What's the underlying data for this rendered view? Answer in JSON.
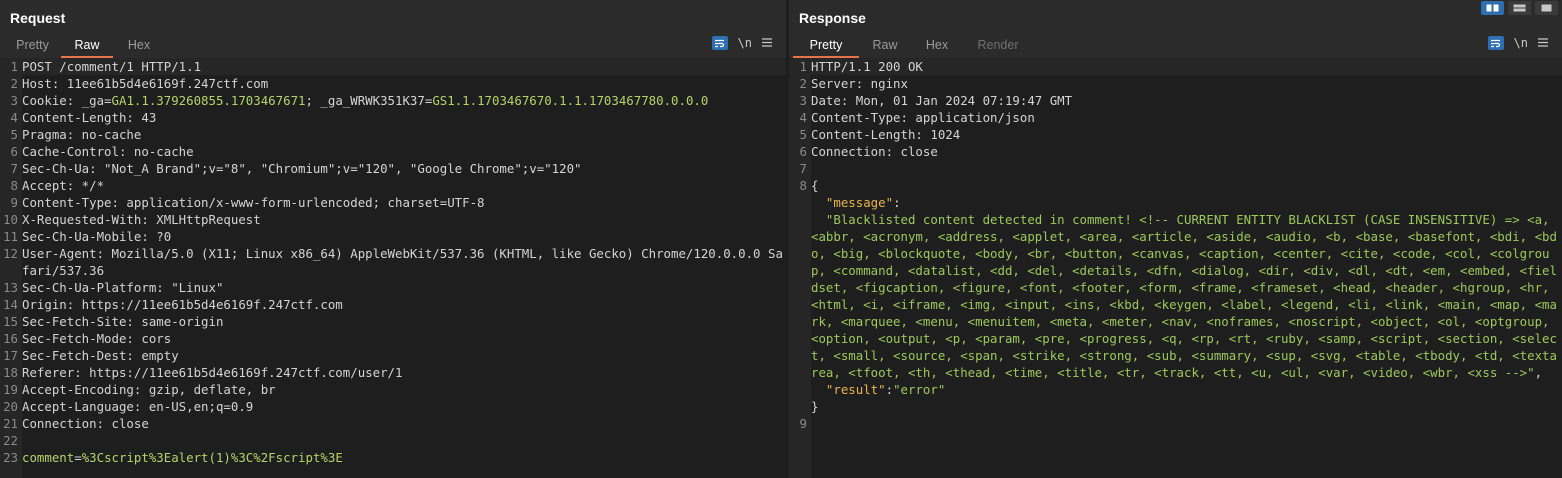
{
  "request": {
    "title": "Request",
    "tabs": [
      "Pretty",
      "Raw",
      "Hex"
    ],
    "active_tab": "Raw",
    "toolbar": {
      "newline_label": "\\n",
      "menu_icon": "hamburger-icon",
      "wrap_icon": "wrap-lines-icon"
    },
    "lines": [
      {
        "n": "1",
        "parts": [
          {
            "t": "POST /comment/1 HTTP/1.1"
          }
        ]
      },
      {
        "n": "2",
        "parts": [
          {
            "t": "Host: 11ee61b5d4e6169f.247ctf.com"
          }
        ]
      },
      {
        "n": "3",
        "parts": [
          {
            "t": "Cookie: _ga="
          },
          {
            "t": "GA1.1.379260855.1703467671",
            "c": "g"
          },
          {
            "t": "; _ga_WRWK351K37="
          },
          {
            "t": "GS1.1.1703467670.1.1.1703467780.0.0.0",
            "c": "g"
          }
        ]
      },
      {
        "n": "4",
        "parts": [
          {
            "t": "Content-Length: 43"
          }
        ]
      },
      {
        "n": "5",
        "parts": [
          {
            "t": "Pragma: no-cache"
          }
        ]
      },
      {
        "n": "6",
        "parts": [
          {
            "t": "Cache-Control: no-cache"
          }
        ]
      },
      {
        "n": "7",
        "parts": [
          {
            "t": "Sec-Ch-Ua: \"Not_A Brand\";v=\"8\", \"Chromium\";v=\"120\", \"Google Chrome\";v=\"120\""
          }
        ]
      },
      {
        "n": "8",
        "parts": [
          {
            "t": "Accept: */*"
          }
        ]
      },
      {
        "n": "9",
        "parts": [
          {
            "t": "Content-Type: application/x-www-form-urlencoded; charset=UTF-8"
          }
        ]
      },
      {
        "n": "10",
        "parts": [
          {
            "t": "X-Requested-With: XMLHttpRequest"
          }
        ]
      },
      {
        "n": "11",
        "parts": [
          {
            "t": "Sec-Ch-Ua-Mobile: ?0"
          }
        ]
      },
      {
        "n": "12",
        "parts": [
          {
            "t": "User-Agent: Mozilla/5.0 (X11; Linux x86_64) AppleWebKit/537.36 (KHTML, like Gecko) Chrome/120.0.0.0 Safari/537.36"
          }
        ]
      },
      {
        "n": "13",
        "parts": [
          {
            "t": "Sec-Ch-Ua-Platform: \"Linux\""
          }
        ]
      },
      {
        "n": "14",
        "parts": [
          {
            "t": "Origin: https://11ee61b5d4e6169f.247ctf.com"
          }
        ]
      },
      {
        "n": "15",
        "parts": [
          {
            "t": "Sec-Fetch-Site: same-origin"
          }
        ]
      },
      {
        "n": "16",
        "parts": [
          {
            "t": "Sec-Fetch-Mode: cors"
          }
        ]
      },
      {
        "n": "17",
        "parts": [
          {
            "t": "Sec-Fetch-Dest: empty"
          }
        ]
      },
      {
        "n": "18",
        "parts": [
          {
            "t": "Referer: https://11ee61b5d4e6169f.247ctf.com/user/1"
          }
        ]
      },
      {
        "n": "19",
        "parts": [
          {
            "t": "Accept-Encoding: gzip, deflate, br"
          }
        ]
      },
      {
        "n": "20",
        "parts": [
          {
            "t": "Accept-Language: en-US,en;q=0.9"
          }
        ]
      },
      {
        "n": "21",
        "parts": [
          {
            "t": "Connection: close"
          }
        ]
      },
      {
        "n": "22",
        "parts": [
          {
            "t": ""
          }
        ]
      },
      {
        "n": "23",
        "parts": [
          {
            "t": "comment",
            "c": "g"
          },
          {
            "t": "="
          },
          {
            "t": "%3Cscript%3Ealert(1)%3C%2Fscript%3E",
            "c": "g"
          }
        ]
      }
    ]
  },
  "response": {
    "title": "Response",
    "tabs": [
      "Pretty",
      "Raw",
      "Hex",
      "Render"
    ],
    "active_tab": "Pretty",
    "disabled_tab": "Render",
    "toolbar": {
      "newline_label": "\\n",
      "menu_icon": "hamburger-icon",
      "wrap_icon": "wrap-lines-icon"
    },
    "lines": [
      {
        "n": "1",
        "parts": [
          {
            "t": "HTTP/1.1 200 OK"
          }
        ]
      },
      {
        "n": "2",
        "parts": [
          {
            "t": "Server: nginx"
          }
        ]
      },
      {
        "n": "3",
        "parts": [
          {
            "t": "Date: Mon, 01 Jan 2024 07:19:47 GMT"
          }
        ]
      },
      {
        "n": "4",
        "parts": [
          {
            "t": "Content-Type: application/json"
          }
        ]
      },
      {
        "n": "5",
        "parts": [
          {
            "t": "Content-Length: 1024"
          }
        ]
      },
      {
        "n": "6",
        "parts": [
          {
            "t": "Connection: close"
          }
        ]
      },
      {
        "n": "7",
        "parts": [
          {
            "t": ""
          }
        ]
      },
      {
        "n": "8",
        "parts": [
          {
            "t": "{"
          }
        ]
      },
      {
        "n": "",
        "parts": [
          {
            "t": "  "
          },
          {
            "t": "\"message\"",
            "c": "key"
          },
          {
            "t": ":"
          }
        ]
      },
      {
        "n": "",
        "parts": [
          {
            "t": "  "
          },
          {
            "t": "\"Blacklisted content detected in comment! <!-- CURRENT ENTITY BLACKLIST (CASE INSENSITIVE) => <a, <abbr, <acronym, <address, <applet, <area, <article, <aside, <audio, <b, <base, <basefont, <bdi, <bdo, <big, <blockquote, <body, <br, <button, <canvas, <caption, <center, <cite, <code, <col, <colgroup, <command, <datalist, <dd, <del, <details, <dfn, <dialog, <dir, <div, <dl, <dt, <em, <embed, <fieldset, <figcaption, <figure, <font, <footer, <form, <frame, <frameset, <head, <header, <hgroup, <hr, <html, <i, <iframe, <img, <input, <ins, <kbd, <keygen, <label, <legend, <li, <link, <main, <map, <mark, <marquee, <menu, <menuitem, <meta, <meter, <nav, <noframes, <noscript, <object, <ol, <optgroup, <option, <output, <p, <param, <pre, <progress, <q, <rp, <rt, <ruby, <samp, <script, <section, <select, <small, <source, <span, <strike, <strong, <sub, <summary, <sup, <svg, <table, <tbody, <td, <textarea, <tfoot, <th, <thead, <time, <title, <tr, <track, <tt, <u, <ul, <var, <video, <wbr, <xss -->\"",
            "c": "str"
          },
          {
            "t": ","
          }
        ]
      },
      {
        "n": "",
        "parts": [
          {
            "t": "  "
          },
          {
            "t": "\"result\"",
            "c": "key"
          },
          {
            "t": ":"
          },
          {
            "t": "\"error\"",
            "c": "str"
          }
        ]
      },
      {
        "n": "",
        "parts": [
          {
            "t": "}"
          }
        ]
      },
      {
        "n": "9",
        "parts": [
          {
            "t": ""
          }
        ]
      }
    ]
  },
  "layout_switch": [
    "split-horizontal-icon",
    "split-vertical-icon",
    "single-pane-icon"
  ]
}
